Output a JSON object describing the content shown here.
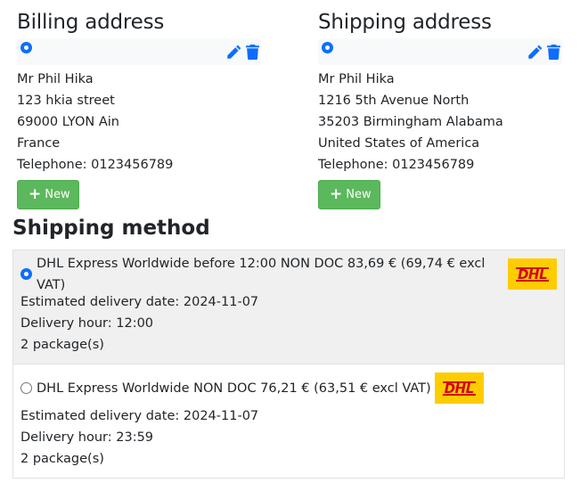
{
  "billing": {
    "title": "Billing address",
    "lines": [
      "Mr Phil Hika",
      "123 hkia street",
      "69000 LYON Ain",
      "France",
      "Telephone: 0123456789"
    ],
    "new_label": "New"
  },
  "shipping": {
    "title": "Shipping address",
    "lines": [
      "Mr Phil Hika",
      "1216 5th Avenue North",
      "35203 Birmingham Alabama",
      "United States of America",
      "Telephone: 0123456789"
    ],
    "new_label": "New"
  },
  "shipping_method": {
    "title": "Shipping method",
    "options": [
      {
        "label": "DHL Express Worldwide before 12:00 NON DOC 83,69 € (69,74 € excl VAT)",
        "selected": true,
        "delivery_date": "Estimated delivery date: 2024-11-07",
        "delivery_hour": "Delivery hour: 12:00",
        "packages": "2 package(s)",
        "logo_text": "DHL"
      },
      {
        "label": "DHL Express Worldwide NON DOC 76,21 € (63,51 € excl VAT)",
        "selected": false,
        "delivery_date": "Estimated delivery date: 2024-11-07",
        "delivery_hour": "Delivery hour: 23:59",
        "packages": "2 package(s)",
        "logo_text": "DHL"
      }
    ]
  },
  "icons": {
    "edit": "pencil-icon",
    "delete": "trash-icon",
    "add": "plus-icon"
  },
  "colors": {
    "accent": "#0d6efd",
    "new_button": "#5cb85c",
    "dhl_yellow": "#ffcc00",
    "dhl_red": "#d40511"
  }
}
